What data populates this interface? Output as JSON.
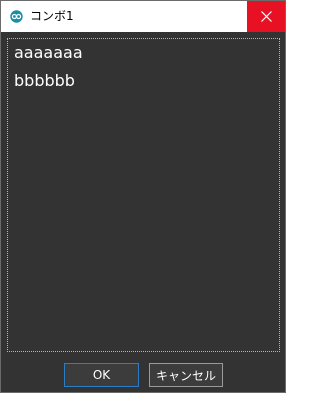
{
  "window": {
    "title": "コンボ1",
    "close_icon": "close-icon",
    "app_icon": "app-icon"
  },
  "list": {
    "items": [
      {
        "label": "aaaaaaa"
      },
      {
        "label": "bbbbbb"
      }
    ]
  },
  "buttons": {
    "ok_label": "OK",
    "cancel_label": "キャンセル"
  },
  "colors": {
    "close_button": "#e81123",
    "background": "#333333",
    "ok_border": "#2a7dc7"
  }
}
